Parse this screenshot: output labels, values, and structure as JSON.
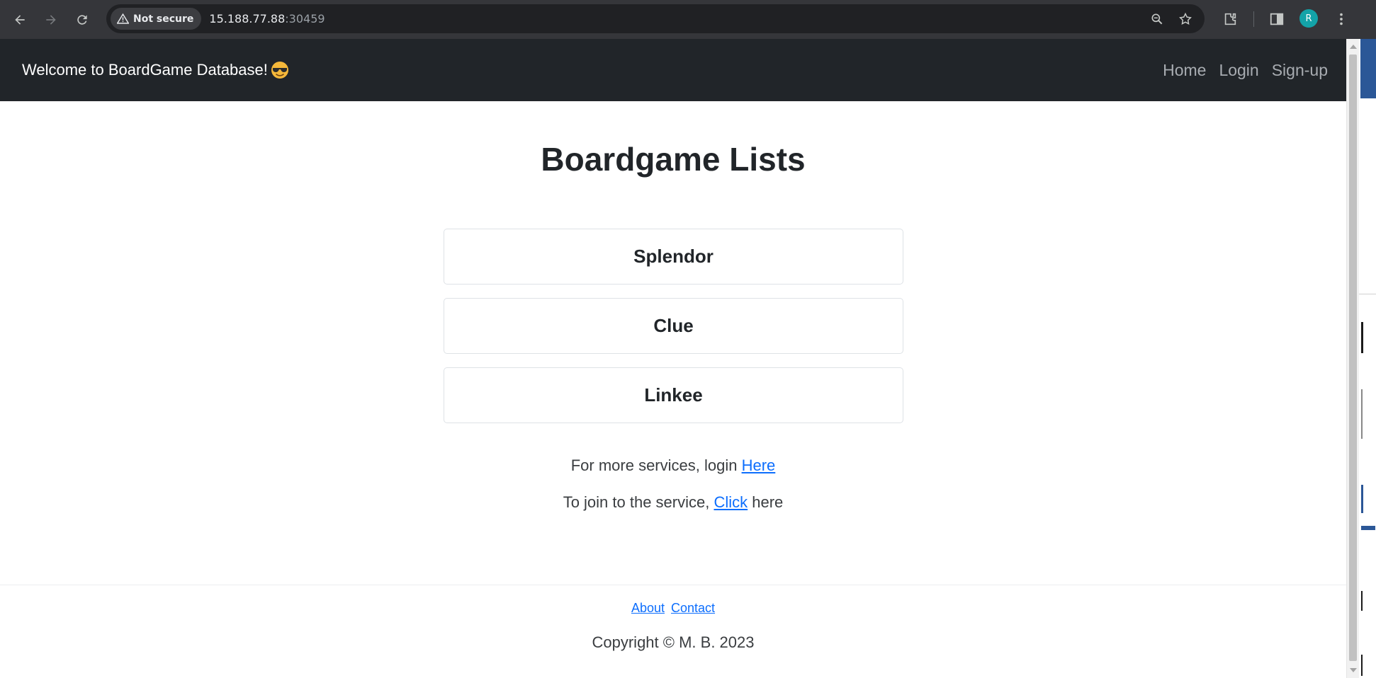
{
  "browser": {
    "security_label": "Not secure",
    "url_host": "15.188.77.88",
    "url_port": ":30459",
    "profile_initial": "R",
    "icons": [
      "back-icon",
      "forward-icon",
      "reload-icon",
      "warning-icon",
      "zoom-icon",
      "bookmark-star-icon",
      "extensions-icon",
      "side-panel-icon",
      "menu-kebab-icon"
    ]
  },
  "navbar": {
    "brand": "Welcome to BoardGame Database!",
    "brand_emoji": "sunglasses-face-emoji",
    "links": [
      "Home",
      "Login",
      "Sign-up"
    ]
  },
  "main": {
    "title": "Boardgame Lists",
    "games": [
      "Splendor",
      "Clue",
      "Linkee"
    ],
    "login_prompt": {
      "before": "For more services, login ",
      "link": "Here"
    },
    "join_prompt": {
      "before": "To join to the service, ",
      "link": "Click",
      "after": " here"
    }
  },
  "footer": {
    "links": [
      "About",
      "Contact"
    ],
    "copyright": "Copyright © M. B. 2023"
  },
  "colors": {
    "chrome_bg": "#35363a",
    "navbar_bg": "#212529",
    "link": "#0d6efd",
    "avatar": "#13a3a8"
  }
}
